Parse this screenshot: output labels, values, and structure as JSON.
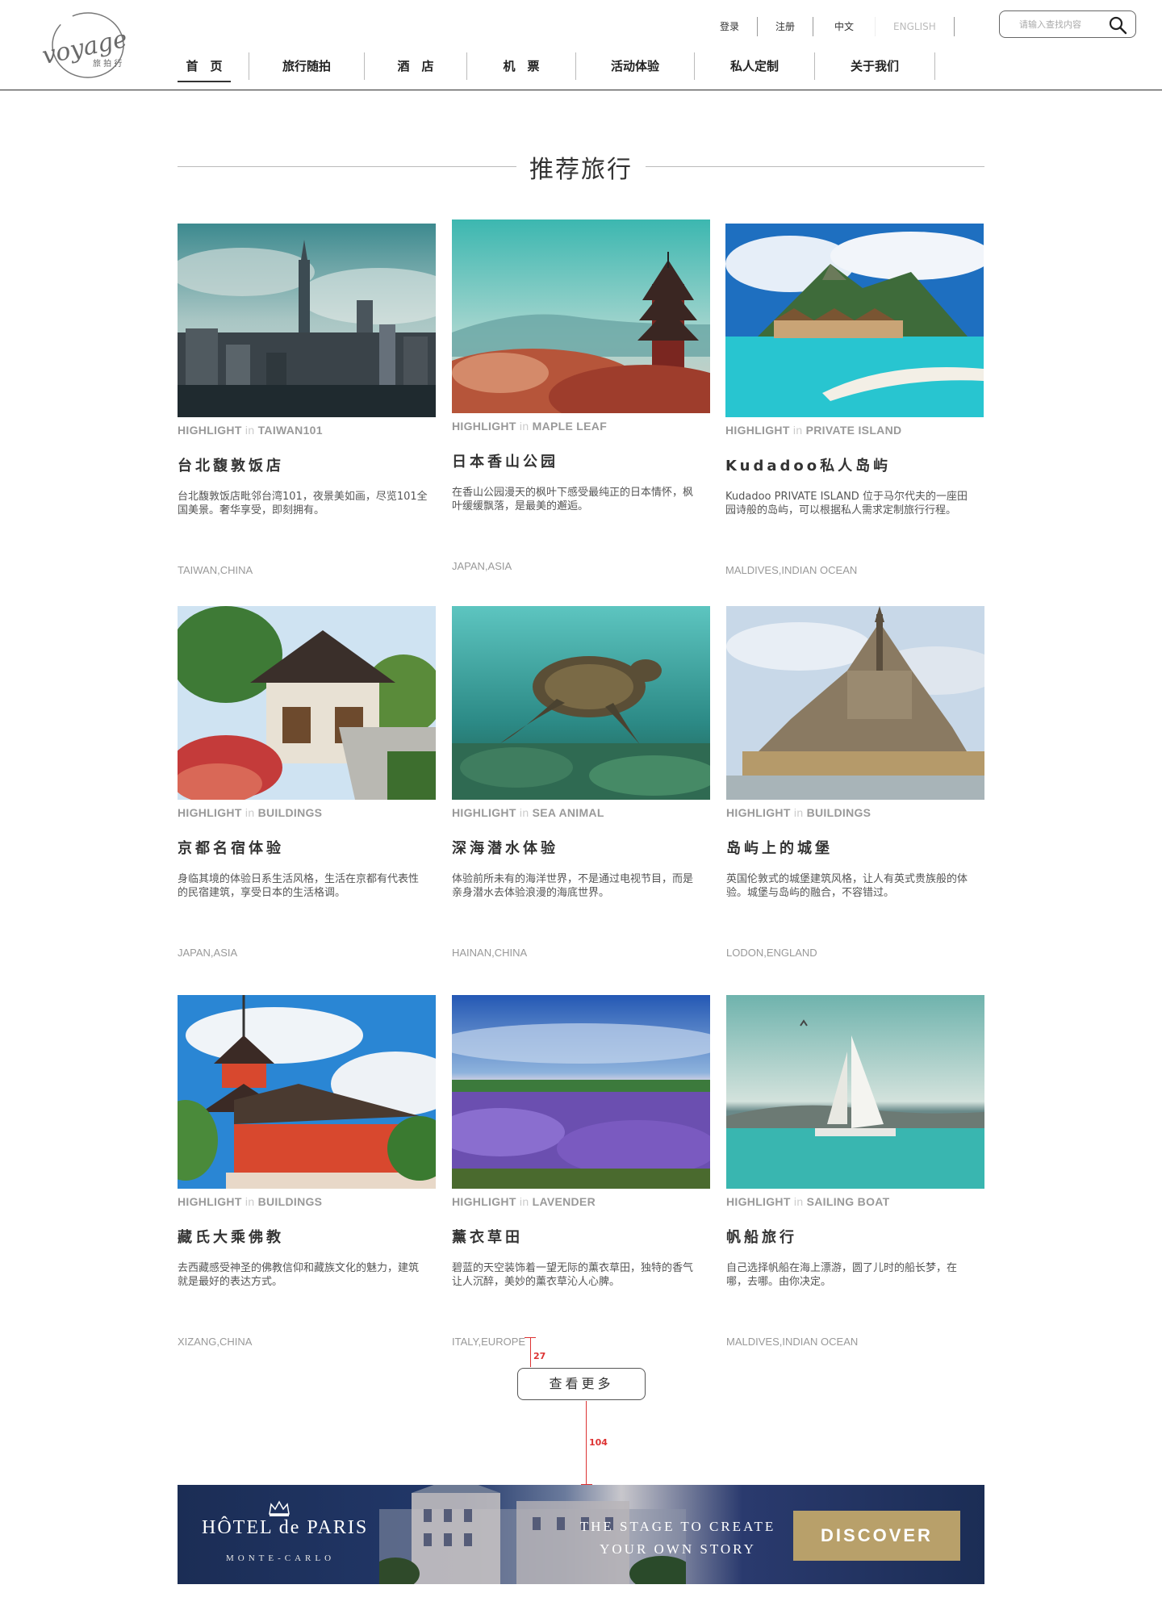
{
  "logo": {
    "text": "voyage",
    "subtitle": "旅 拍 行"
  },
  "topbar": {
    "login": "登录",
    "register": "注册",
    "lang_cn": "中文",
    "lang_en": "ENGLISH"
  },
  "search": {
    "placeholder": "请输入查找内容"
  },
  "nav": {
    "items": [
      {
        "label": "首　页"
      },
      {
        "label": "旅行随拍"
      },
      {
        "label": "酒　店"
      },
      {
        "label": "机　票"
      },
      {
        "label": "活动体验"
      },
      {
        "label": "私人定制"
      },
      {
        "label": "关于我们"
      }
    ]
  },
  "section": {
    "title": "推荐旅行"
  },
  "highlight_word": "HIGHLIGHT",
  "in_word": "in",
  "cards": [
    {
      "tag": "TAIWAN101",
      "title": "台北馥敦饭店",
      "desc": "台北馥敦饭店毗邻台湾101，夜景美如画，尽览101全国美景。奢华享受，即刻拥有。",
      "location": "TAIWAN,CHINA"
    },
    {
      "tag": "MAPLE LEAF",
      "title": "日本香山公园",
      "desc": "在香山公园漫天的枫叶下感受最纯正的日本情怀，枫叶缓缓飘落，是最美的邂逅。",
      "location": "JAPAN,ASIA"
    },
    {
      "tag": "PRIVATE ISLAND",
      "title": "Kudadoo私人岛屿",
      "desc": "Kudadoo PRIVATE ISLAND 位于马尔代夫的一座田园诗般的岛屿，可以根据私人需求定制旅行行程。",
      "location": "MALDIVES,INDIAN OCEAN"
    },
    {
      "tag": "BUILDINGS",
      "title": "京都名宿体验",
      "desc": "身临其境的体验日系生活风格，生活在京都有代表性的民宿建筑，享受日本的生活格调。",
      "location": "JAPAN,ASIA"
    },
    {
      "tag": "SEA ANIMAL",
      "title": "深海潜水体验",
      "desc": "体验前所未有的海洋世界，不是通过电视节目，而是亲身潜水去体验浪漫的海底世界。",
      "location": "HAINAN,CHINA"
    },
    {
      "tag": "BUILDINGS",
      "title": "岛屿上的城堡",
      "desc": "英国伦敦式的城堡建筑风格，让人有英式贵族般的体验。城堡与岛屿的融合，不容错过。",
      "location": "LODON,ENGLAND"
    },
    {
      "tag": "BUILDINGS",
      "title": "藏氏大乘佛教",
      "desc": "去西藏感受神圣的佛教信仰和藏族文化的魅力，建筑就是最好的表达方式。",
      "location": "XIZANG,CHINA"
    },
    {
      "tag": "LAVENDER",
      "title": "薰衣草田",
      "desc": "碧蓝的天空装饰着一望无际的薰衣草田，独特的香气让人沉醉，美妙的薰衣草沁人心脾。",
      "location": "ITALY,EUROPE"
    },
    {
      "tag": "SAILING BOAT",
      "title": "帆船旅行",
      "desc": "自己选择帆船在海上漂游，圆了儿时的船长梦，在哪，去哪。由你决定。",
      "location": "MALDIVES,INDIAN OCEAN"
    }
  ],
  "more_button": "查看更多",
  "annotations": {
    "gap_top": "27",
    "gap_bottom": "104"
  },
  "banner": {
    "brand": "HÔTEL de PARIS",
    "brand_sub": "MONTE-CARLO",
    "slogan_line1": "THE STAGE TO CREATE",
    "slogan_line2": "YOUR OWN STORY",
    "cta": "DISCOVER"
  },
  "colors": {
    "accent_gold": "#b8a06a",
    "banner_navy": "#1b2d55",
    "text_dark": "#333333",
    "text_muted": "#999999"
  }
}
